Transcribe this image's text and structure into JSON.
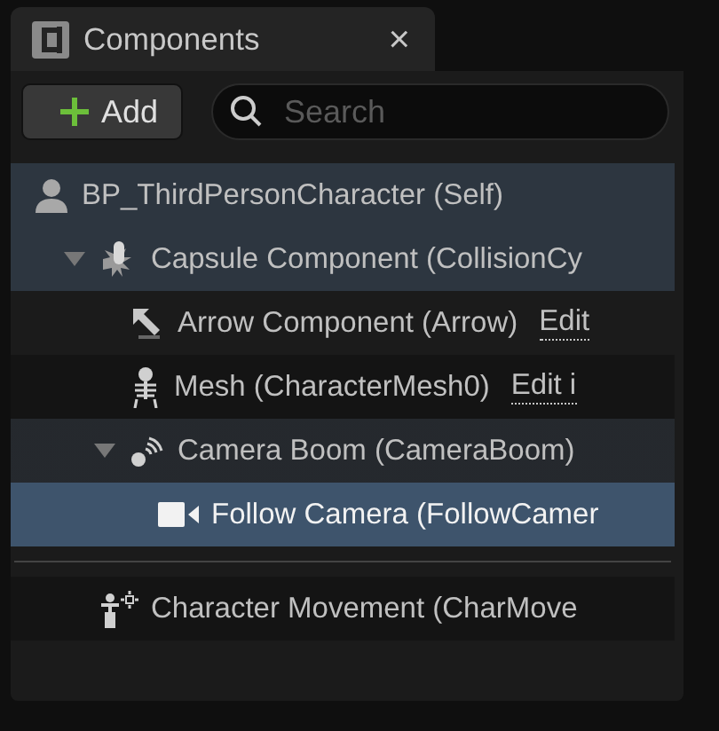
{
  "tab": {
    "title": "Components",
    "close": "×"
  },
  "toolbar": {
    "add_button": "Add",
    "search": {
      "placeholder": "Search"
    }
  },
  "tree": [
    {
      "kind": "self",
      "label": "BP_ThirdPersonCharacter (Self)",
      "selected": false,
      "highlighted": true,
      "hovered": false,
      "children": [
        {
          "kind": "capsule",
          "label": "Capsule Component (CollisionCy",
          "expanded": true,
          "selected": false,
          "highlighted": true,
          "hovered": false,
          "children": [
            {
              "kind": "arrow",
              "label": "Arrow Component (Arrow)",
              "edit_link": "Edit",
              "selected": false,
              "highlighted": false,
              "hovered": false
            },
            {
              "kind": "mesh",
              "label": "Mesh (CharacterMesh0)",
              "edit_link": "Edit i",
              "selected": false,
              "highlighted": false,
              "hovered": false
            },
            {
              "kind": "spring-arm",
              "label": "Camera Boom (CameraBoom)",
              "expanded": true,
              "selected": false,
              "highlighted": false,
              "hovered": true,
              "children": [
                {
                  "kind": "camera",
                  "label": "Follow Camera (FollowCamer",
                  "selected": true,
                  "highlighted": false,
                  "hovered": false
                }
              ]
            }
          ]
        }
      ]
    }
  ],
  "other_components": [
    {
      "kind": "movement",
      "label": "Character Movement (CharMove",
      "selected": false,
      "highlighted": false,
      "hovered": false
    }
  ]
}
